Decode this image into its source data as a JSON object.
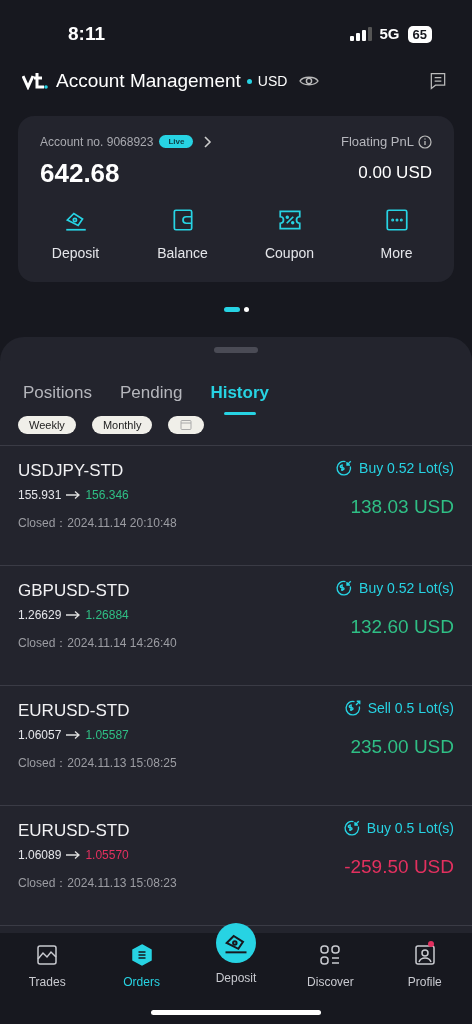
{
  "status_bar": {
    "time": "8:11",
    "network": "5G",
    "battery": "65"
  },
  "header": {
    "title": "Account Management",
    "currency": "USD"
  },
  "account_card": {
    "account_label": "Account no. 9068923",
    "badge": "Live",
    "balance": "642.68",
    "pnl_label": "Floating PnL",
    "pnl_value": "0.00 USD",
    "actions": [
      {
        "kind": "deposit",
        "label": "Deposit"
      },
      {
        "kind": "balance",
        "label": "Balance"
      },
      {
        "kind": "coupon",
        "label": "Coupon"
      },
      {
        "kind": "more",
        "label": "More"
      }
    ]
  },
  "pager": [
    {
      "selected": true
    },
    {
      "selected": false
    }
  ],
  "tabs": [
    {
      "label": "Positions",
      "selected": false
    },
    {
      "label": "Pending",
      "selected": false
    },
    {
      "label": "History",
      "selected": true
    }
  ],
  "filters": [
    {
      "kind": "text",
      "label": "Weekly"
    },
    {
      "kind": "text",
      "label": "Monthly"
    },
    {
      "kind": "calendar"
    }
  ],
  "trades": [
    {
      "symbol": "USDJPY-STD",
      "open": "155.931",
      "close": "156.346",
      "loss": false,
      "closed": "Closed：2024.11.14 20:10:48",
      "kind": "buy",
      "lots": "Buy 0.52 Lot(s)",
      "pnl": "138.03 USD"
    },
    {
      "symbol": "GBPUSD-STD",
      "open": "1.26629",
      "close": "1.26884",
      "loss": false,
      "closed": "Closed：2024.11.14 14:26:40",
      "kind": "buy",
      "lots": "Buy 0.52 Lot(s)",
      "pnl": "132.60 USD"
    },
    {
      "symbol": "EURUSD-STD",
      "open": "1.06057",
      "close": "1.05587",
      "loss": false,
      "closed": "Closed：2024.11.13 15:08:25",
      "kind": "sell",
      "lots": "Sell 0.5 Lot(s)",
      "pnl": "235.00 USD"
    },
    {
      "symbol": "EURUSD-STD",
      "open": "1.06089",
      "close": "1.05570",
      "loss": true,
      "closed": "Closed：2024.11.13 15:08:23",
      "kind": "buy",
      "lots": "Buy 0.5 Lot(s)",
      "pnl": "-259.50 USD"
    }
  ],
  "bottom_nav": [
    {
      "kind": "trades",
      "label": "Trades",
      "selected": false,
      "badge": false
    },
    {
      "kind": "orders",
      "label": "Orders",
      "selected": true,
      "badge": false
    },
    {
      "kind": "deposit",
      "label": "Deposit",
      "selected": false,
      "badge": false
    },
    {
      "kind": "discover",
      "label": "Discover",
      "selected": false,
      "badge": false
    },
    {
      "kind": "profile",
      "label": "Profile",
      "selected": false,
      "badge": true
    }
  ]
}
